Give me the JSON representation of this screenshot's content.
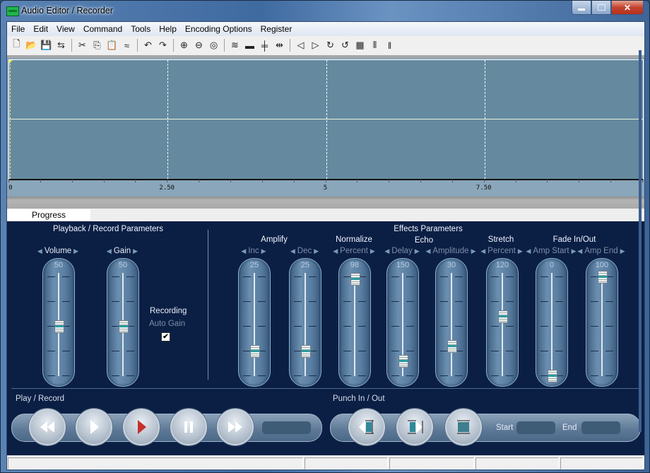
{
  "window": {
    "title": "Audio Editor / Recorder",
    "controls": {
      "minimize": "—",
      "maximize": "☐",
      "close": "✕"
    }
  },
  "menu": [
    "File",
    "Edit",
    "View",
    "Command",
    "Tools",
    "Help",
    "Encoding Options",
    "Register"
  ],
  "toolbar": {
    "groups": [
      [
        {
          "name": "new-icon",
          "glyph": "🗋"
        },
        {
          "name": "open-icon",
          "glyph": "📂"
        },
        {
          "name": "save-icon",
          "glyph": "💾"
        },
        {
          "name": "settings-icon",
          "glyph": "⇆"
        }
      ],
      [
        {
          "name": "cut-icon",
          "glyph": "✂"
        },
        {
          "name": "copy-icon",
          "glyph": "⎘"
        },
        {
          "name": "paste-icon",
          "glyph": "📋"
        },
        {
          "name": "mix-paste-icon",
          "glyph": "≈"
        }
      ],
      [
        {
          "name": "undo-icon",
          "glyph": "↶"
        },
        {
          "name": "redo-icon",
          "glyph": "↷"
        }
      ],
      [
        {
          "name": "zoom-in-icon",
          "glyph": "⊕"
        },
        {
          "name": "zoom-out-icon",
          "glyph": "⊖"
        },
        {
          "name": "zoom-fit-icon",
          "glyph": "◎"
        }
      ],
      [
        {
          "name": "waveform-icon",
          "glyph": "≋"
        },
        {
          "name": "silence-icon",
          "glyph": "▬"
        },
        {
          "name": "compress-icon",
          "glyph": "╪"
        },
        {
          "name": "expand-icon",
          "glyph": "⇹"
        }
      ],
      [
        {
          "name": "fade-in-icon",
          "glyph": "◁"
        },
        {
          "name": "fade-out-icon",
          "glyph": "▷"
        },
        {
          "name": "reverse-icon",
          "glyph": "↻"
        },
        {
          "name": "loop-icon",
          "glyph": "↺"
        },
        {
          "name": "noise-icon",
          "glyph": "▦"
        },
        {
          "name": "mark-icon",
          "glyph": "⦀"
        },
        {
          "name": "trim-icon",
          "glyph": "‖"
        }
      ]
    ]
  },
  "waveform": {
    "ruler_labels": [
      "0",
      "2.50",
      "5",
      "7.50"
    ],
    "ruler_label_units": [
      0,
      2.5,
      5,
      7.5
    ],
    "visible_range": [
      0,
      10
    ],
    "colors": {
      "background": "#658a9f",
      "centerline": "#e8f0e0",
      "cursor": "#f2e34a"
    }
  },
  "tabs": {
    "progress": "Progress"
  },
  "playback": {
    "title": "Playback / Record Parameters",
    "sliders": [
      {
        "label": "Volume",
        "value": "50",
        "fraction": 0.5,
        "active": true
      },
      {
        "label": "Gain",
        "value": "50",
        "fraction": 0.5,
        "active": true
      }
    ],
    "recording_label": "Recording",
    "auto_gain_label": "Auto Gain",
    "auto_gain_checked": "✔"
  },
  "effects": {
    "title": "Effects Parameters",
    "groups": [
      {
        "title": "Amplify"
      },
      {
        "title": "Normalize"
      },
      {
        "title": "Echo"
      },
      {
        "title": "Stretch"
      },
      {
        "title": "Fade In/Out"
      }
    ],
    "sliders": [
      {
        "label": "Inc",
        "value": "25",
        "fraction": 0.25
      },
      {
        "label": "Dec",
        "value": "25",
        "fraction": 0.25
      },
      {
        "label": "Percent",
        "value": "98",
        "fraction": 0.98
      },
      {
        "label": "Delay",
        "value": "150",
        "fraction": 0.15
      },
      {
        "label": "Amplitude",
        "value": "30",
        "fraction": 0.3
      },
      {
        "label": "Percent",
        "value": "120",
        "fraction": 0.6
      },
      {
        "label": "Amp Start",
        "value": "0",
        "fraction": 0.0
      },
      {
        "label": "Amp End",
        "value": "100",
        "fraction": 1.0
      }
    ]
  },
  "play_record": {
    "title": "Play / Record",
    "buttons": [
      "rewind",
      "play",
      "record",
      "pause",
      "fast-forward"
    ],
    "time_display": ""
  },
  "punch": {
    "title": "Punch In / Out",
    "buttons": [
      "punch-in",
      "punch-out",
      "punch-region"
    ],
    "start_label": "Start",
    "start_value": "",
    "end_label": "End",
    "end_value": ""
  },
  "status_bar": [
    "",
    "",
    "",
    "",
    ""
  ]
}
